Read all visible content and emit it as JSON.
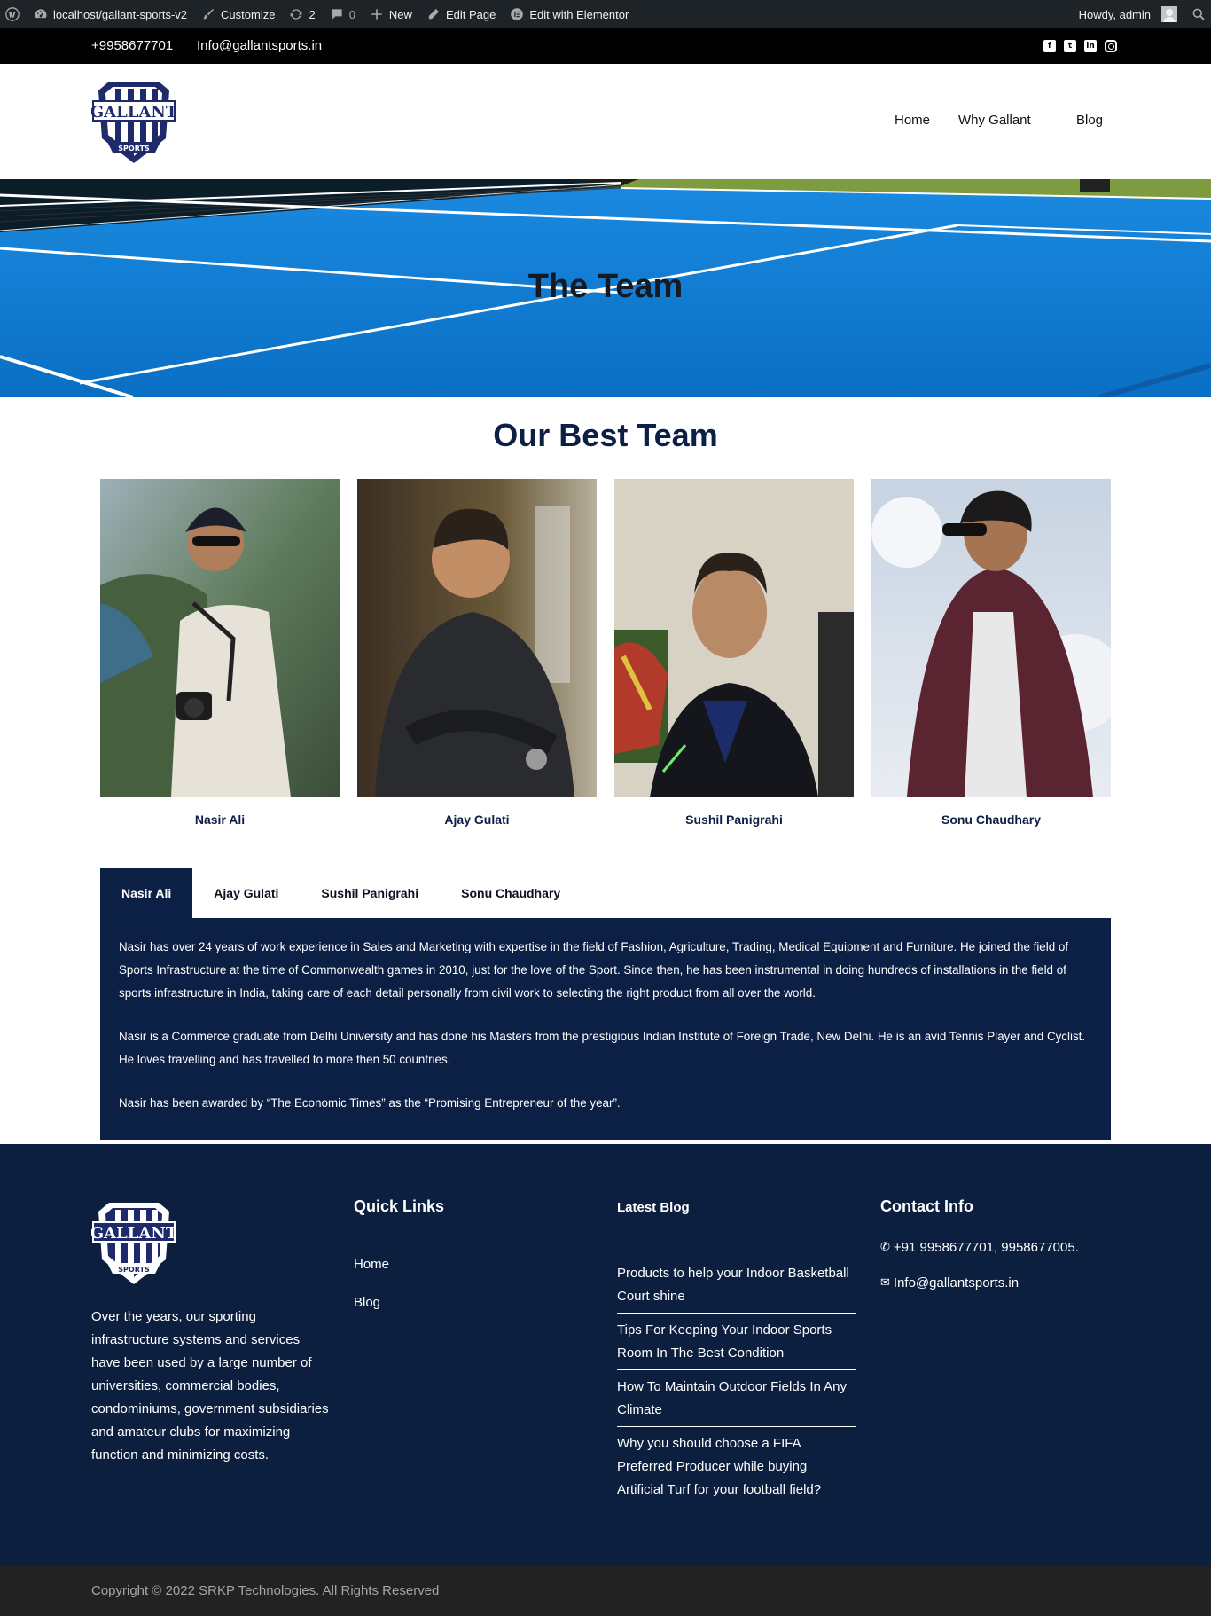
{
  "admin_bar": {
    "site": "localhost/gallant-sports-v2",
    "customize": "Customize",
    "updates_count": "2",
    "comments_count": "0",
    "new": "New",
    "edit_page": "Edit Page",
    "edit_elementor": "Edit with Elementor",
    "greeting": "Howdy, admin"
  },
  "topbar": {
    "phone": "+9958677701",
    "email": "Info@gallantsports.in",
    "social_icons": [
      "facebook-icon",
      "twitter-icon",
      "linkedin-icon",
      "instagram-icon"
    ]
  },
  "logo": {
    "text": "GALLANT",
    "sub": "SPORTS"
  },
  "nav": {
    "items": [
      "Home",
      "Why Gallant",
      "Blog"
    ]
  },
  "hero": {
    "title": "The Team"
  },
  "team": {
    "title": "Our Best Team",
    "members": [
      {
        "name": "Nasir Ali"
      },
      {
        "name": "Ajay Gulati"
      },
      {
        "name": "Sushil Panigrahi"
      },
      {
        "name": "Sonu Chaudhary"
      }
    ]
  },
  "tabs": {
    "labels": [
      "Nasir Ali",
      "Ajay Gulati",
      "Sushil Panigrahi",
      "Sonu Chaudhary"
    ],
    "active": "Nasir Ali",
    "paragraphs": [
      "Nasir has over 24 years of work experience in Sales and Marketing with expertise in the field of Fashion, Agriculture, Trading, Medical Equipment and Furniture. He joined the field of Sports Infrastructure at the time of Commonwealth games in 2010, just for the love of the Sport. Since then, he has been instrumental in doing hundreds of installations in the field of sports infrastructure in India, taking care of each detail personally from civil work to selecting the right product from all over the world.",
      "Nasir is a Commerce graduate from Delhi University and has done his Masters from the prestigious Indian Institute of Foreign Trade, New Delhi. He is an avid Tennis Player and Cyclist. He loves travelling and has travelled to more then 50 countries.",
      "Nasir has been awarded by “The Economic Times” as the “Promising Entrepreneur of the year”."
    ]
  },
  "footer": {
    "about": "Over the years, our sporting infrastructure systems and services have been used by a large number of universities, commercial bodies, condominiums, government subsidiaries and amateur clubs for maximizing function and minimizing costs.",
    "quick_links_title": "Quick Links",
    "quick_links": [
      "Home",
      "Blog"
    ],
    "latest_blog_title": "Latest Blog",
    "blog_posts": [
      "Products to help your Indoor Basketball Court shine",
      "Tips For Keeping Your Indoor Sports Room In The Best Condition",
      "How To Maintain Outdoor Fields In Any Climate",
      "Why you should choose a FIFA Preferred Producer while buying Artificial Turf for your football field?"
    ],
    "contact_title": "Contact Info",
    "contact_phone": "+91 9958677701, 9958677005.",
    "contact_email": "Info@gallantsports.in"
  },
  "copyright": "Copyright © 2022 SRKP Technologies. All Rights Reserved"
}
